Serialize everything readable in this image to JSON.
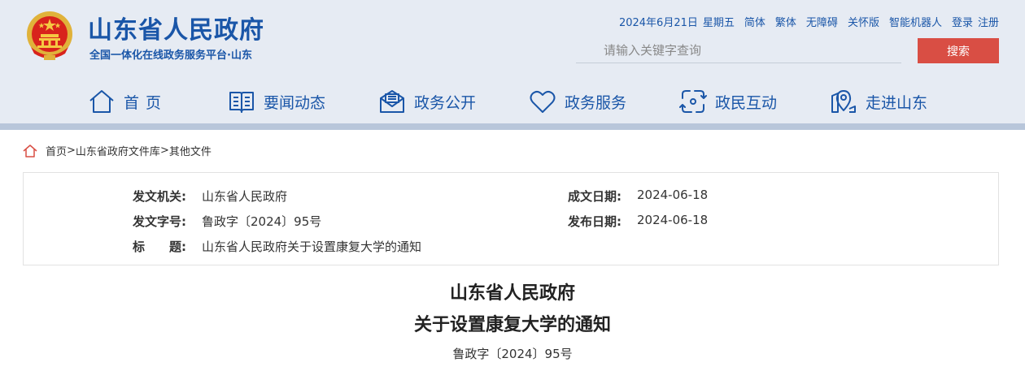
{
  "header": {
    "title": "山东省人民政府",
    "subtitle": "全国一体化在线政务服务平台·山东",
    "date": "2024年6月21日",
    "weekday": "星期五",
    "links": [
      "简体",
      "繁体",
      "无障碍",
      "关怀版",
      "智能机器人"
    ],
    "login": "登录",
    "register": "注册",
    "search_placeholder": "请输入关键字查询",
    "search_button": "搜索"
  },
  "nav": [
    {
      "label": "首页",
      "icon": "home-icon"
    },
    {
      "label": "要闻动态",
      "icon": "book-icon"
    },
    {
      "label": "政务公开",
      "icon": "mail-icon"
    },
    {
      "label": "政务服务",
      "icon": "heart-icon"
    },
    {
      "label": "政民互动",
      "icon": "exchange-icon"
    },
    {
      "label": "走进山东",
      "icon": "location-icon"
    }
  ],
  "breadcrumb": [
    "首页",
    "山东省政府文件库",
    "其他文件"
  ],
  "meta": {
    "issuer_label": "发文机关:",
    "issuer": "山东省人民政府",
    "doc_number_label": "发文字号:",
    "doc_number": "鲁政字〔2024〕95号",
    "title_label": "标　　题:",
    "title": "山东省人民政府关于设置康复大学的通知",
    "written_date_label": "成文日期:",
    "written_date": "2024-06-18",
    "publish_date_label": "发布日期:",
    "publish_date": "2024-06-18"
  },
  "document": {
    "title_line1": "山东省人民政府",
    "title_line2": "关于设置康复大学的通知",
    "number": "鲁政字〔2024〕95号"
  },
  "colors": {
    "brand_blue": "#1a56a8",
    "search_red": "#d94e44",
    "header_bg": "#e6ebf3"
  }
}
